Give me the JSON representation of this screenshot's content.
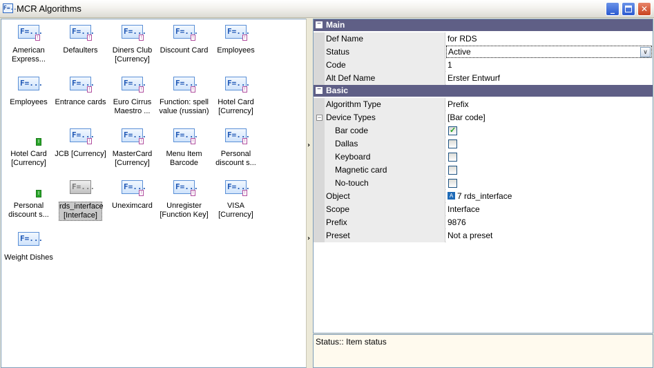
{
  "window": {
    "title": "MCR Algorithms",
    "icon": "algorithm-app-icon",
    "icon_text": "F=..",
    "minimize_glyph": "_",
    "close_glyph": "✕"
  },
  "icon_text": "F=...",
  "algorithms": [
    {
      "label": "American Express...",
      "icon": "algorithm-f-icon",
      "badge": true
    },
    {
      "label": "Defaulters",
      "icon": "algorithm-f-icon",
      "badge": true
    },
    {
      "label": "Diners Club [Currency]",
      "icon": "algorithm-f-icon",
      "badge": true
    },
    {
      "label": "Discount Card",
      "icon": "algorithm-f-icon",
      "badge": true
    },
    {
      "label": "Employees",
      "icon": "algorithm-f-icon",
      "badge": true
    },
    {
      "label": "Employees",
      "icon": "algorithm-f-icon",
      "badge": false
    },
    {
      "label": "Entrance cards",
      "icon": "algorithm-f-icon",
      "badge": true
    },
    {
      "label": "Euro Cirrus Maestro ...",
      "icon": "algorithm-f-icon",
      "badge": true
    },
    {
      "label": "Function: spell value (russian)",
      "icon": "algorithm-f-icon",
      "badge": true
    },
    {
      "label": "Hotel Card [Currency]",
      "icon": "algorithm-f-icon",
      "badge": true
    },
    {
      "label": "Hotel Card [Currency]",
      "icon": "green-tag-icon",
      "badge": false
    },
    {
      "label": "JCB [Currency]",
      "icon": "algorithm-f-icon",
      "badge": true
    },
    {
      "label": "MasterCard [Currency]",
      "icon": "algorithm-f-icon",
      "badge": true
    },
    {
      "label": "Menu Item Barcode",
      "icon": "algorithm-f-icon",
      "badge": true
    },
    {
      "label": "Personal discount s...",
      "icon": "algorithm-f-icon",
      "badge": true
    },
    {
      "label": "Personal discount s...",
      "icon": "green-tag-icon",
      "badge": false
    },
    {
      "label": "rds_interface [Interface]",
      "icon": "algorithm-f-icon",
      "badge": false,
      "selected": true
    },
    {
      "label": "Uneximcard",
      "icon": "algorithm-f-icon",
      "badge": true
    },
    {
      "label": "Unregister [Function Key]",
      "icon": "algorithm-f-icon",
      "badge": true
    },
    {
      "label": "VISA [Currency]",
      "icon": "algorithm-f-icon",
      "badge": true
    },
    {
      "label": "Weight Dishes",
      "icon": "algorithm-f-icon",
      "badge": false
    }
  ],
  "properties": {
    "main": {
      "label": "Main",
      "def_name": {
        "name": "Def Name",
        "value": "for RDS"
      },
      "status": {
        "name": "Status",
        "value": "Active"
      },
      "code": {
        "name": "Code",
        "value": "1"
      },
      "alt_def_name": {
        "name": "Alt Def Name",
        "value": "Erster Entwurf"
      }
    },
    "basic": {
      "label": "Basic",
      "algorithm_type": {
        "name": "Algorithm Type",
        "value": "Prefix"
      },
      "device_types": {
        "name": "Device Types",
        "value": "[Bar code]"
      },
      "devices": [
        {
          "name": "Bar code",
          "checked": true
        },
        {
          "name": "Dallas",
          "checked": false
        },
        {
          "name": "Keyboard",
          "checked": false
        },
        {
          "name": "Magnetic card",
          "checked": false
        },
        {
          "name": "No-touch",
          "checked": false
        }
      ],
      "object": {
        "name": "Object",
        "value": "7 rds_interface",
        "icon": "object-icon"
      },
      "scope": {
        "name": "Scope",
        "value": "Interface"
      },
      "prefix": {
        "name": "Prefix",
        "value": "9876"
      },
      "preset": {
        "name": "Preset",
        "value": "Not a preset"
      }
    }
  },
  "status_bar": {
    "text": "Status:: Item status"
  },
  "colors": {
    "category_header": "#5f5f86",
    "status_background": "#fffaee",
    "checkmark": "#21a121"
  }
}
